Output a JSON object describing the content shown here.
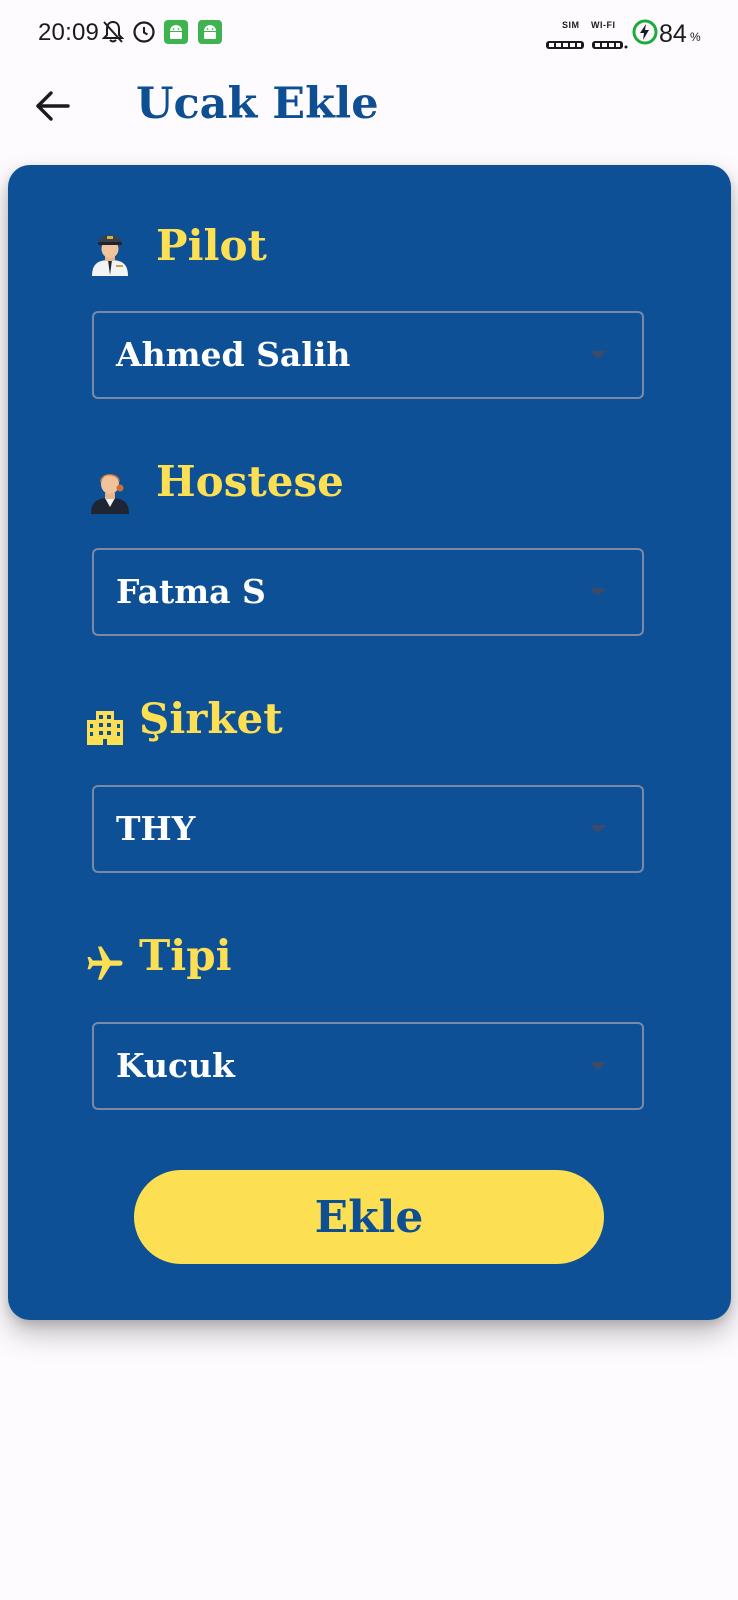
{
  "status_bar": {
    "time": "20:09",
    "sim_label": "SIM",
    "wifi_label": "WI-FI",
    "battery_percent": "84",
    "battery_symbol": "%",
    "icons": [
      "bell-off-icon",
      "alarm-icon",
      "android-app-icon",
      "android-app-icon",
      "battery-charging-icon"
    ]
  },
  "app_bar": {
    "title": "Ucak Ekle",
    "back_icon": "arrow-left-icon"
  },
  "form": {
    "fields": [
      {
        "label": "Pilot",
        "value": "Ahmed Salih",
        "icon": "pilot-icon"
      },
      {
        "label": "Hostese",
        "value": "Fatma S",
        "icon": "stewardess-icon"
      },
      {
        "label": "Şirket",
        "value": "THY",
        "icon": "building-icon"
      },
      {
        "label": "Tipi",
        "value": "Kucuk",
        "icon": "airplane-icon"
      }
    ],
    "submit_label": "Ekle"
  },
  "colors": {
    "card_background": "#0e5096",
    "accent_yellow": "#fddf53",
    "title_blue": "#0e4f94",
    "page_background": "#fefbff"
  }
}
